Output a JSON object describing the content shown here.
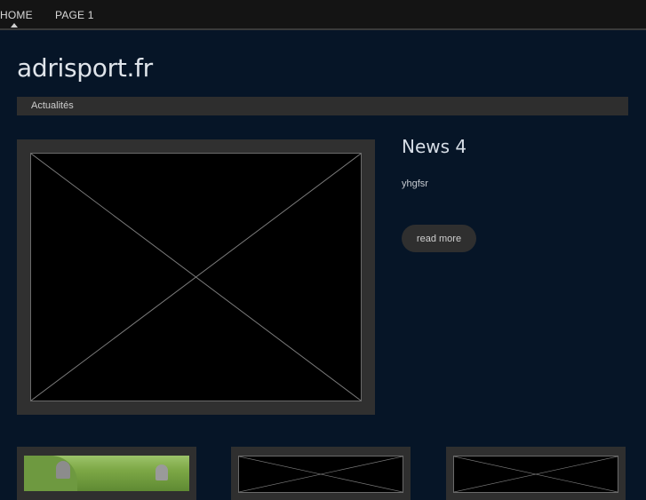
{
  "nav": {
    "items": [
      {
        "label": "HOME"
      },
      {
        "label": "PAGE 1"
      }
    ]
  },
  "site": {
    "title": "adrisport.fr"
  },
  "category_bar": {
    "label": "Actualités"
  },
  "article": {
    "title": "News 4",
    "body": "yhgfsr",
    "read_more_label": "read more"
  },
  "colors": {
    "background": "#061527",
    "nav_background": "#141414",
    "frame": "#303030",
    "button": "#2f2f2f"
  },
  "icons": {
    "active_indicator": "triangle-up-icon",
    "image_placeholder": "image-placeholder-icon"
  }
}
